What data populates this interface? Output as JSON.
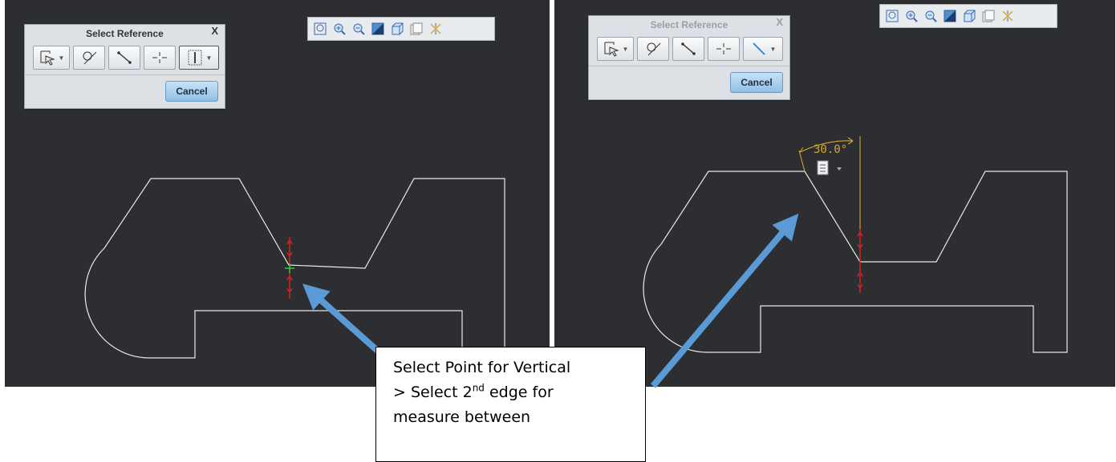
{
  "left": {
    "dialog": {
      "title": "Select Reference",
      "close": "X",
      "tools": [
        "select-filter-icon",
        "circle-reference-icon",
        "line-reference-icon",
        "center-point-icon",
        "vertical-line-icon"
      ],
      "cancel": "Cancel"
    },
    "view_toolbar": [
      "zoom-fit-icon",
      "zoom-in-icon",
      "zoom-out-icon",
      "display-style-icon",
      "view-orientation-icon",
      "saved-views-icon",
      "datum-display-icon"
    ]
  },
  "right": {
    "dialog": {
      "title": "Select Reference",
      "close": "X",
      "tools": [
        "select-filter-icon",
        "circle-reference-icon",
        "line-reference-icon",
        "center-point-icon",
        "angled-line-icon"
      ],
      "cancel": "Cancel"
    },
    "view_toolbar": [
      "zoom-fit-icon",
      "zoom-in-icon",
      "zoom-out-icon",
      "display-style-icon",
      "view-orientation-icon",
      "saved-views-icon",
      "datum-display-icon"
    ],
    "dimension": "30.0°"
  },
  "callout": {
    "line1": "Select Point for Vertical",
    "line2_pre": "> Select 2",
    "line2_sup": "nd",
    "line2_post": " edge for",
    "line3": "measure between"
  },
  "colors": {
    "background": "#2c2e31",
    "sketch": "#e8e8e8",
    "dimension": "#d4a72c",
    "constraint": "#e02020",
    "arrow": "#5b9bd5"
  }
}
